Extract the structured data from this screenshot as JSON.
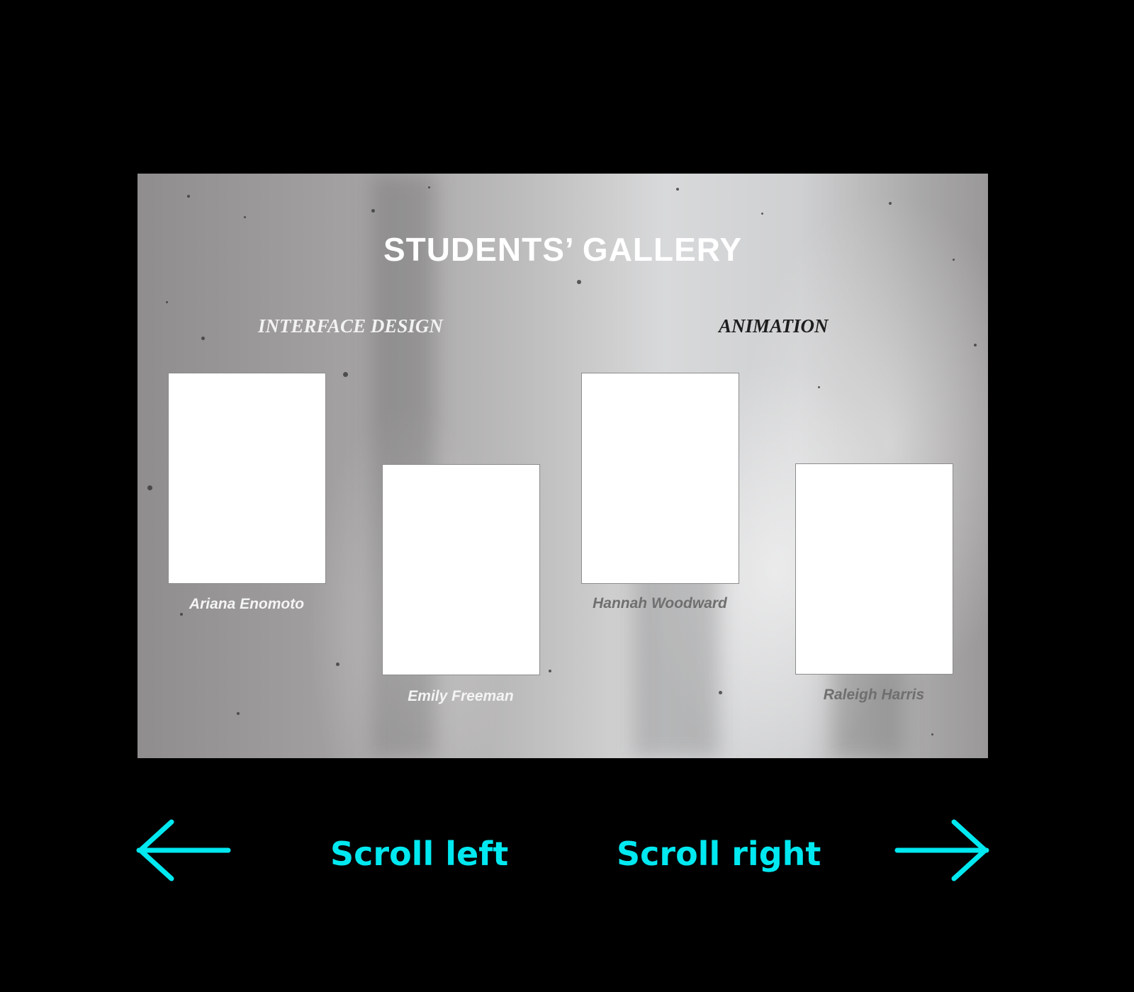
{
  "gallery": {
    "title": "STUDENTS’ GALLERY",
    "sections": [
      {
        "label": "INTERFACE DESIGN"
      },
      {
        "label": "ANIMATION"
      }
    ],
    "students": [
      {
        "name": "Ariana Enomoto"
      },
      {
        "name": "Emily Freeman"
      },
      {
        "name": "Hannah Woodward"
      },
      {
        "name": "Raleigh Harris"
      }
    ]
  },
  "navigation": {
    "scroll_left_label": "Scroll left",
    "scroll_right_label": "Scroll right",
    "left_icon": "arrow-left-icon",
    "right_icon": "arrow-right-icon"
  },
  "colors": {
    "background": "#000000",
    "accent": "#00e8f0",
    "card": "#ffffff"
  }
}
